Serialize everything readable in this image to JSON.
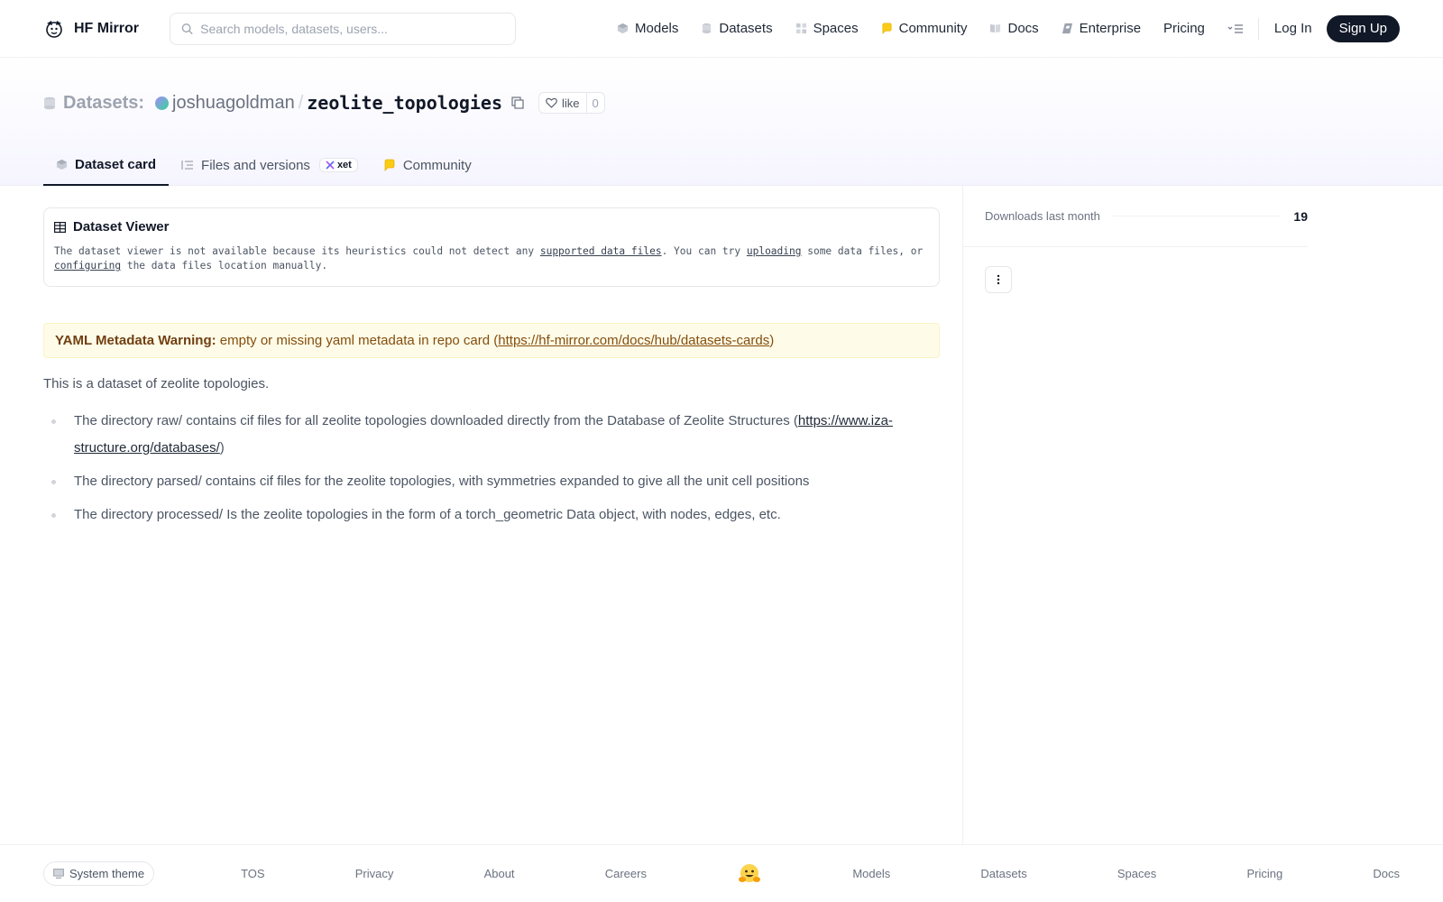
{
  "brand": {
    "name": "HF Mirror"
  },
  "search": {
    "placeholder": "Search models, datasets, users..."
  },
  "nav": {
    "items": [
      {
        "label": "Models"
      },
      {
        "label": "Datasets"
      },
      {
        "label": "Spaces"
      },
      {
        "label": "Community"
      },
      {
        "label": "Docs"
      },
      {
        "label": "Enterprise"
      },
      {
        "label": "Pricing"
      }
    ],
    "login": "Log In",
    "signup": "Sign Up"
  },
  "repo": {
    "type_label": "Datasets:",
    "owner": "joshuagoldman",
    "separator": "/",
    "name": "zeolite_topologies",
    "like_label": "like",
    "like_count": "0"
  },
  "tabs": [
    {
      "label": "Dataset card",
      "active": true
    },
    {
      "label": "Files and versions",
      "badge": "xet"
    },
    {
      "label": "Community"
    }
  ],
  "viewer": {
    "title": "Dataset Viewer",
    "msg_part1": "The dataset viewer is not available because its heuristics could not detect any ",
    "link1": "supported data files",
    "msg_part2": ". You can try ",
    "link2": "uploading",
    "msg_part3": " some data files, or ",
    "link3": "configuring",
    "msg_part4": " the data files location manually."
  },
  "warning": {
    "title": "YAML Metadata Warning:",
    "text": " empty or missing yaml metadata in repo card (",
    "link": "https://hf-mirror.com/docs/hub/datasets-cards",
    "close": ")"
  },
  "card": {
    "intro": "This is a dataset of zeolite topologies.",
    "bullet1_text": "The directory raw/ contains cif files for all zeolite topologies downloaded directly from the Database of Zeolite Structures (",
    "bullet1_link": "https://www.iza-structure.org/databases/",
    "bullet1_close": ")",
    "bullet2": "The directory parsed/ contains cif files for the zeolite topologies, with symmetries expanded to give all the unit cell positions",
    "bullet3": "The directory processed/ Is the zeolite topologies in the form of a torch_geometric Data object, with nodes, edges, etc."
  },
  "sidebar": {
    "downloads_label": "Downloads last month",
    "downloads_value": "19"
  },
  "footer": {
    "theme": "System theme",
    "links": [
      "TOS",
      "Privacy",
      "About",
      "Careers",
      "Models",
      "Datasets",
      "Spaces",
      "Pricing",
      "Docs"
    ]
  },
  "colors": {
    "primary_dark": "#111827",
    "warning_bg": "#fefce8",
    "warning_text": "#854d0e"
  }
}
